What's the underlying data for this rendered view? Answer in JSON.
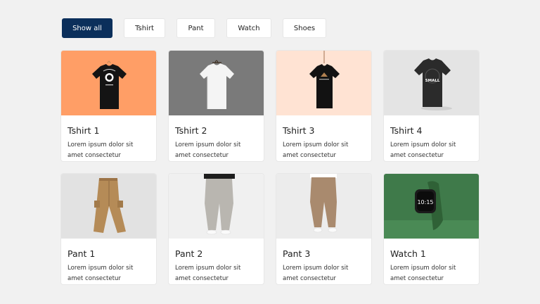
{
  "filters": [
    {
      "label": "Show all",
      "active": true
    },
    {
      "label": "Tshirt",
      "active": false
    },
    {
      "label": "Pant",
      "active": false
    },
    {
      "label": "Watch",
      "active": false
    },
    {
      "label": "Shoes",
      "active": false
    }
  ],
  "products": [
    {
      "title": "Tshirt 1",
      "desc": "Lorem ipsum dolor sit amet consectetur adipisicing elit.",
      "bg": "#ff9e66",
      "image": "black-tshirt"
    },
    {
      "title": "Tshirt 2",
      "desc": "Lorem ipsum dolor sit amet consectetur adipisicing elit.",
      "bg": "#7a7a7a",
      "image": "white-tshirt"
    },
    {
      "title": "Tshirt 3",
      "desc": "Lorem ipsum dolor sit amet consectetur adipisicing elit.",
      "bg": "#ffe3d3",
      "image": "black-tshirt"
    },
    {
      "title": "Tshirt 4",
      "desc": "Lorem ipsum dolor sit amet consectetur adipisicing elit.",
      "bg": "#e4e4e4",
      "image": "black-tshirt-small"
    },
    {
      "title": "Pant 1",
      "desc": "Lorem ipsum dolor sit amet consectetur adipisicing elit.",
      "bg": "#e2e2e2",
      "image": "cargo-pant"
    },
    {
      "title": "Pant 2",
      "desc": "Lorem ipsum dolor sit amet consectetur adipisicing elit.",
      "bg": "#f0f0f0",
      "image": "grey-pant"
    },
    {
      "title": "Pant 3",
      "desc": "Lorem ipsum dolor sit amet consectetur adipisicing elit.",
      "bg": "#ececec",
      "image": "khaki-pant"
    },
    {
      "title": "Watch 1",
      "desc": "Lorem ipsum dolor sit amet consectetur adipisicing elit.",
      "bg": "#3f7a4a",
      "image": "smart-watch",
      "watch_time": "10:15"
    }
  ],
  "tshirt4_print": "SMALL"
}
